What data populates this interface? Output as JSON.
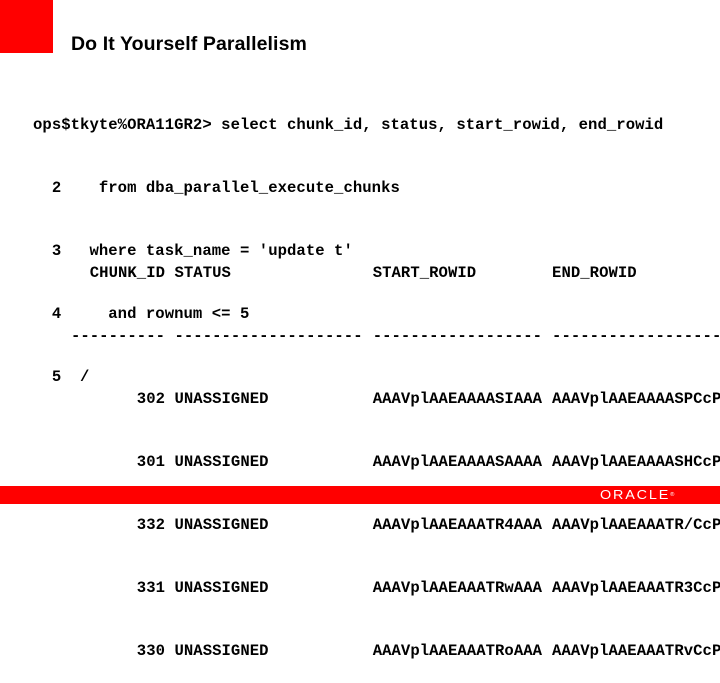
{
  "slide": {
    "title": "Do It Yourself Parallelism",
    "brand_color": "#ff0000",
    "background_color": "#ffffff"
  },
  "sql_session": {
    "lines": [
      "ops$tkyte%ORA11GR2> select chunk_id, status, start_rowid, end_rowid",
      "  2    from dba_parallel_execute_chunks",
      "  3   where task_name = 'update t'",
      "  4     and rownum <= 5",
      "  5  /"
    ]
  },
  "result_table": {
    "columns": [
      {
        "header": "CHUNK_ID",
        "separator": "----------"
      },
      {
        "header": "STATUS",
        "separator": "--------------------"
      },
      {
        "header": "START_ROWID",
        "separator": "------------------"
      },
      {
        "header": "END_ROWID",
        "separator": "------------------"
      }
    ],
    "rows": [
      {
        "chunk_id": "302",
        "status": "UNASSIGNED",
        "start_rowid": "AAAVplAAEAAAASIAAA",
        "end_rowid": "AAAVplAAEAAAASPCcP"
      },
      {
        "chunk_id": "301",
        "status": "UNASSIGNED",
        "start_rowid": "AAAVplAAEAAAASAAAA",
        "end_rowid": "AAAVplAAEAAAASHCcP"
      },
      {
        "chunk_id": "332",
        "status": "UNASSIGNED",
        "start_rowid": "AAAVplAAEAAATR4AAA",
        "end_rowid": "AAAVplAAEAAATR/CcP"
      },
      {
        "chunk_id": "331",
        "status": "UNASSIGNED",
        "start_rowid": "AAAVplAAEAAATRwAAA",
        "end_rowid": "AAAVplAAEAAATR3CcP"
      },
      {
        "chunk_id": "330",
        "status": "UNASSIGNED",
        "start_rowid": "AAAVplAAEAAATRoAAA",
        "end_rowid": "AAAVplAAEAAATRvCcP"
      }
    ]
  },
  "footer": {
    "logo_text": "ORACLE",
    "logo_mark": "®",
    "logo_icon": "oracle-logo"
  }
}
